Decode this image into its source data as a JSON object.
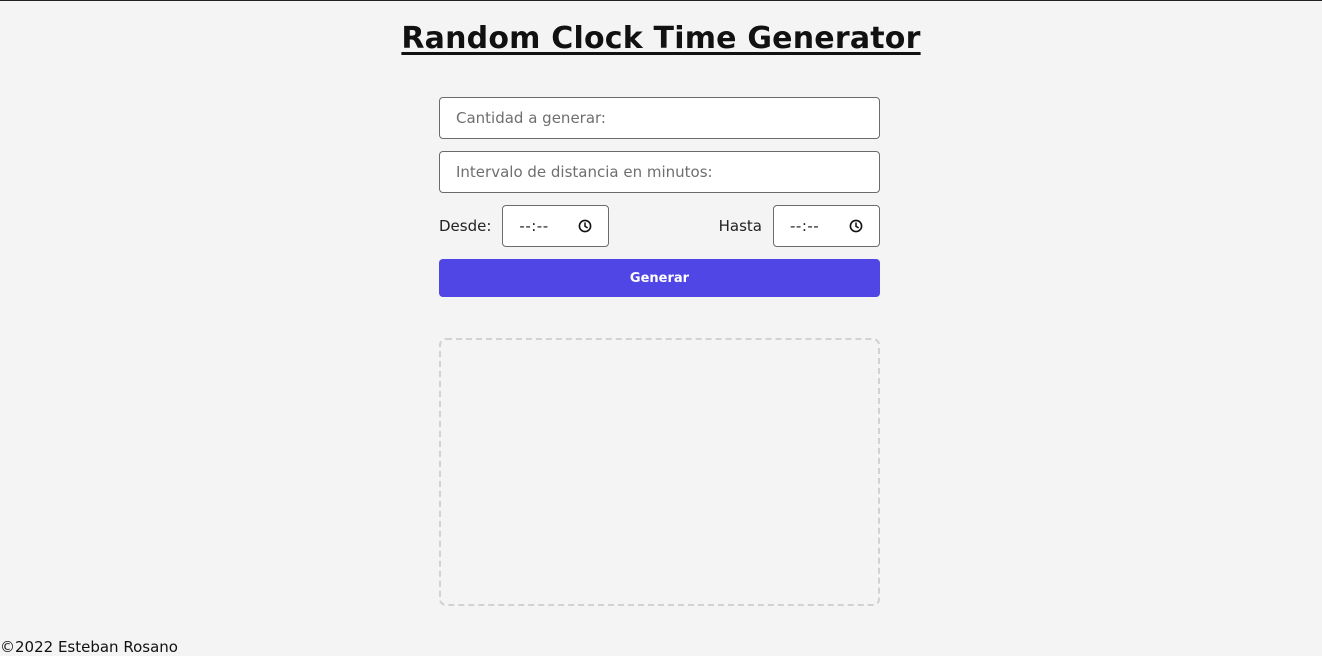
{
  "header": {
    "title": "Random Clock Time Generator"
  },
  "form": {
    "quantity_placeholder": "Cantidad a generar:",
    "interval_placeholder": "Intervalo de distancia en minutos:",
    "from_label": "Desde:",
    "from_value": "--:--",
    "to_label": "Hasta",
    "to_value": "--:--",
    "generate_label": "Generar"
  },
  "icons": {
    "time_picker": "clock-icon"
  },
  "colors": {
    "accent": "#4f46e5",
    "background": "#f4f4f4",
    "results_border": "#d2d2d2"
  },
  "footer": {
    "text": "©2022 Esteban Rosano"
  }
}
